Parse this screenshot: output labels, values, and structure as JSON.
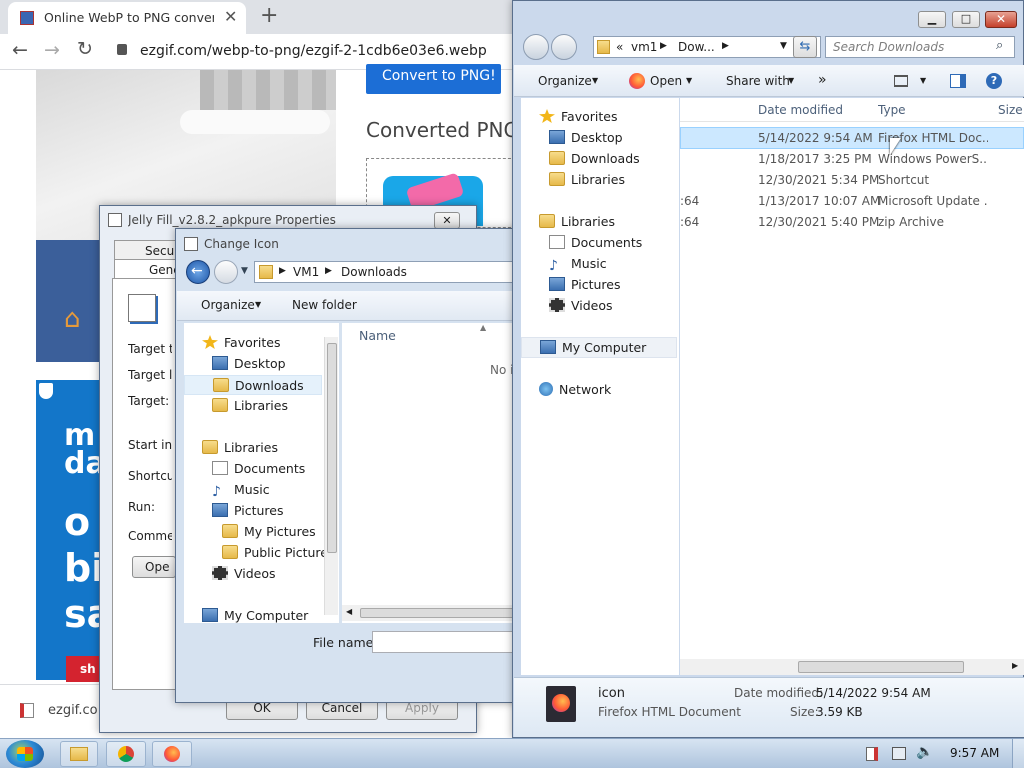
{
  "browser": {
    "tab_title": "Online WebP to PNG converter -",
    "url": "ezgif.com/webp-to-png/ezgif-2-1cdb6e03e6.webp",
    "convert_button": "Convert to PNG!",
    "converted_heading": "Converted PNG",
    "promo_lines": [
      "m",
      "da",
      "o",
      "bi",
      "sa"
    ],
    "promo_cta": "sh",
    "footer_domain": "ezgif.co"
  },
  "properties_dialog": {
    "title": "Jelly Fill_v2.8.2_apkpure Properties",
    "tabs": [
      "Securi",
      "Gene"
    ],
    "fields": [
      "Target ty",
      "Target lo",
      "Target:",
      "Start in:",
      "Shortcut",
      "Run:",
      "Commen"
    ],
    "open_button": "Ope",
    "ok_button": "OK",
    "cancel_button": "Cancel",
    "apply_button": "Apply"
  },
  "change_icon": {
    "title": "Change Icon",
    "breadcrumb": [
      "VM1",
      "Downloads"
    ],
    "toolbar": {
      "organize": "Organize",
      "new_folder": "New folder"
    },
    "tree": [
      {
        "label": "Favorites",
        "icon": "star-icon"
      },
      {
        "label": "Desktop",
        "icon": "desktop-icon"
      },
      {
        "label": "Downloads",
        "icon": "downloads-folder-icon"
      },
      {
        "label": "Libraries",
        "icon": "libraries-icon"
      },
      {
        "label": "Libraries",
        "icon": "libraries-icon"
      },
      {
        "label": "Documents",
        "icon": "document-icon"
      },
      {
        "label": "Music",
        "icon": "music-icon"
      },
      {
        "label": "Pictures",
        "icon": "pictures-icon"
      },
      {
        "label": "My Pictures",
        "icon": "folder-icon"
      },
      {
        "label": "Public Pictures",
        "icon": "folder-icon"
      },
      {
        "label": "Videos",
        "icon": "videos-icon"
      },
      {
        "label": "My Computer",
        "icon": "computer-icon"
      }
    ],
    "column_name": "Name",
    "empty_text": "No i",
    "file_name_label": "File name:"
  },
  "explorer": {
    "breadcrumb": [
      "«",
      "vm1",
      "Dow..."
    ],
    "search_placeholder": "Search Downloads",
    "toolbar": {
      "organize": "Organize",
      "open": "Open",
      "share_with": "Share with",
      "more": "»"
    },
    "nav": [
      {
        "label": "Favorites",
        "icon": "star-icon"
      },
      {
        "label": "Desktop",
        "icon": "desktop-icon"
      },
      {
        "label": "Downloads",
        "icon": "downloads-folder-icon"
      },
      {
        "label": "Libraries",
        "icon": "libraries-icon"
      },
      {
        "label": "Libraries",
        "icon": "libraries-icon"
      },
      {
        "label": "Documents",
        "icon": "document-icon"
      },
      {
        "label": "Music",
        "icon": "music-icon"
      },
      {
        "label": "Pictures",
        "icon": "pictures-icon"
      },
      {
        "label": "Videos",
        "icon": "videos-icon"
      },
      {
        "label": "My Computer",
        "icon": "computer-icon"
      },
      {
        "label": "Network",
        "icon": "network-icon"
      }
    ],
    "columns": {
      "date": "Date modified",
      "type": "Type",
      "size": "Size"
    },
    "files": [
      {
        "name_tail": "",
        "date": "5/14/2022 9:54 AM",
        "type": "Firefox HTML Doc..."
      },
      {
        "name_tail": "",
        "date": "1/18/2017 3:25 PM",
        "type": "Windows PowerS..."
      },
      {
        "name_tail": "",
        "date": "12/30/2021 5:34 PM",
        "type": "Shortcut"
      },
      {
        "name_tail": ":64",
        "date": "1/13/2017 10:07 AM",
        "type": "Microsoft Update ..."
      },
      {
        "name_tail": ":64",
        "date": "12/30/2021 5:40 PM",
        "type": "zip Archive"
      }
    ],
    "details": {
      "name": "icon",
      "type": "Firefox HTML Document",
      "date_label": "Date modified:",
      "date_value": "5/14/2022 9:54 AM",
      "size_label": "Size:",
      "size_value": "3.59 KB"
    }
  },
  "taskbar": {
    "clock": "9:57 AM"
  },
  "colors": {
    "accent_blue": "#1a73e8",
    "selection": "#cce8ff",
    "taskbar": "#b7cde5"
  }
}
